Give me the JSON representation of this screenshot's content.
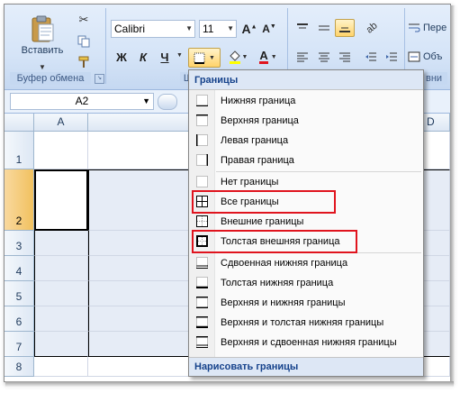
{
  "ribbon": {
    "clipboard": {
      "paste_label": "Вставить",
      "group_title": "Буфер обмена"
    },
    "font": {
      "font_name": "Calibri",
      "font_size": "11",
      "bold": "Ж",
      "italic": "К",
      "underline": "Ч",
      "group_title": "Шр"
    },
    "alignment": {
      "group_title": "вни"
    },
    "wrap": {
      "wrap_label": "Пере",
      "merge_label": "Объ"
    }
  },
  "formula_bar": {
    "name_box": "A2"
  },
  "grid": {
    "columns": [
      "A",
      "",
      "D"
    ],
    "rows": [
      "1",
      "2",
      "3",
      "4",
      "5",
      "6",
      "7",
      "8"
    ]
  },
  "borders_menu": {
    "title": "Границы",
    "items": [
      {
        "label": "Нижняя граница",
        "icon": "bottom-border-icon"
      },
      {
        "label": "Верхняя граница",
        "icon": "top-border-icon"
      },
      {
        "label": "Левая граница",
        "icon": "left-border-icon"
      },
      {
        "label": "Правая граница",
        "icon": "right-border-icon"
      },
      {
        "label": "Нет границы",
        "icon": "no-border-icon"
      },
      {
        "label": "Все границы",
        "icon": "all-borders-icon"
      },
      {
        "label": "Внешние границы",
        "icon": "outside-borders-icon"
      },
      {
        "label": "Толстая внешняя граница",
        "icon": "thick-box-border-icon"
      },
      {
        "label": "Сдвоенная нижняя граница",
        "icon": "double-bottom-border-icon"
      },
      {
        "label": "Толстая нижняя граница",
        "icon": "thick-bottom-border-icon"
      },
      {
        "label": "Верхняя и нижняя границы",
        "icon": "top-bottom-border-icon"
      },
      {
        "label": "Верхняя и толстая нижняя границы",
        "icon": "top-thick-bottom-border-icon"
      },
      {
        "label": "Верхняя и сдвоенная нижняя границы",
        "icon": "top-double-bottom-border-icon"
      }
    ],
    "footer": "Нарисовать границы"
  },
  "colors": {
    "highlight": "#e0141e",
    "selected_row_header": "#f1c15f",
    "menu_header": "#dde7f5"
  }
}
